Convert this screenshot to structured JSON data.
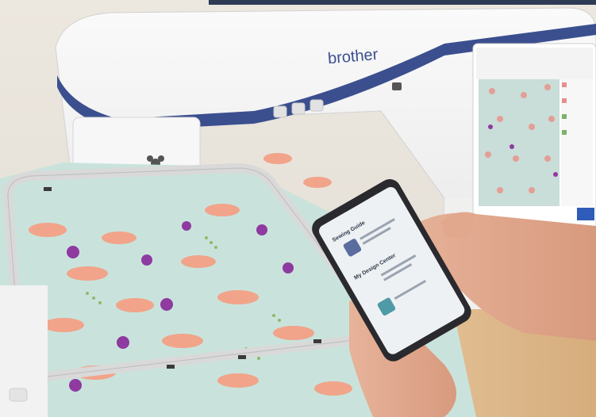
{
  "machine": {
    "brand": "brother",
    "accent_color": "#3b4f8f",
    "body_color": "#f4f4f3",
    "lcd_screen_color": "#d9d7d4"
  },
  "fabric": {
    "background_color": "#c9e3dc",
    "flamingo_color": "#f1a48a",
    "heart_color": "#8e3aa0",
    "dots_color": "#8fb96a"
  },
  "phone": {
    "screen_bg": "#eef1f4",
    "heading_1": "Sewing Guide",
    "heading_2": "My Design Center",
    "icons": [
      "embroidery-design-icon",
      "upload-image-icon"
    ]
  }
}
